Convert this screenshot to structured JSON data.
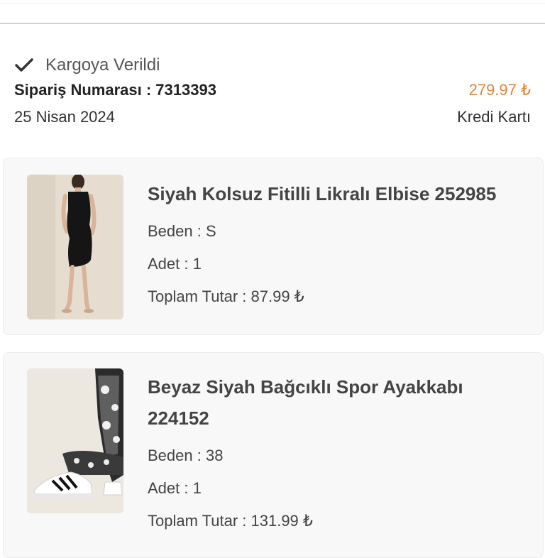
{
  "order": {
    "status": "Kargoya Verildi",
    "number_label": "Sipariş Numarası : 7313393",
    "total": "279.97 ₺",
    "date": "25 Nisan 2024",
    "payment_method": "Kredi Kartı"
  },
  "items": [
    {
      "title": "Siyah Kolsuz Fitilli Likralı Elbise 252985",
      "size": "Beden : S",
      "quantity": "Adet : 1",
      "total": "Toplam Tutar : 87.99 ₺"
    },
    {
      "title": "Beyaz Siyah Bağcıklı Spor Ayakkabı 224152",
      "size": "Beden : 38",
      "quantity": "Adet : 1",
      "total": "Toplam Tutar : 131.99 ₺"
    }
  ],
  "colors": {
    "total_accent": "#e0873a",
    "divider": "#c8dcb4",
    "card_bg": "#f8f8f8"
  },
  "icons": {
    "status": "check-icon"
  }
}
